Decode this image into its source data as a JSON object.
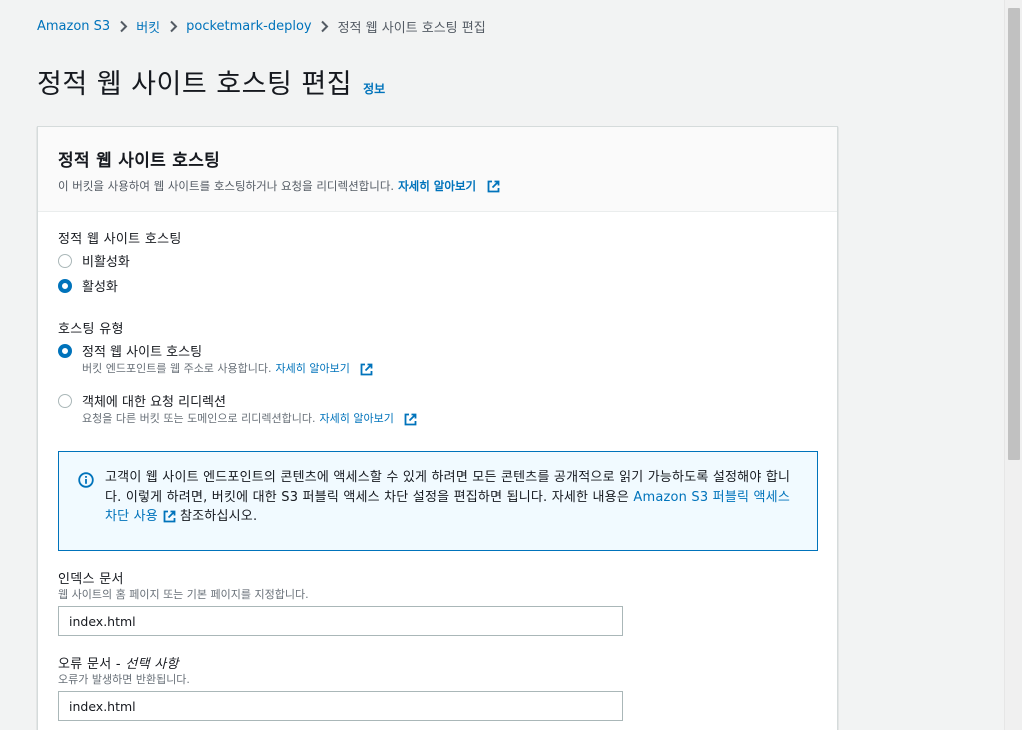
{
  "breadcrumb": {
    "items": [
      "Amazon S3",
      "버킷",
      "pocketmark-deploy"
    ],
    "current": "정적 웹 사이트 호스팅 편집"
  },
  "page": {
    "title": "정적 웹 사이트 호스팅 편집",
    "info_link": "정보"
  },
  "panel": {
    "title": "정적 웹 사이트 호스팅",
    "description": "이 버킷을 사용하여 웹 사이트를 호스팅하거나 요청을 리디렉션합니다.",
    "learn_more": "자세히 알아보기"
  },
  "hosting_toggle": {
    "label": "정적 웹 사이트 호스팅",
    "options": [
      {
        "label": "비활성화",
        "selected": false
      },
      {
        "label": "활성화",
        "selected": true
      }
    ]
  },
  "hosting_type": {
    "label": "호스팅 유형",
    "options": [
      {
        "label": "정적 웹 사이트 호스팅",
        "description": "버킷 엔드포인트를 웹 주소로 사용합니다.",
        "learn_more": "자세히 알아보기",
        "selected": true
      },
      {
        "label": "객체에 대한 요청 리디렉션",
        "description": "요청을 다른 버킷 또는 도메인으로 리디렉션합니다.",
        "learn_more": "자세히 알아보기",
        "selected": false
      }
    ]
  },
  "alert": {
    "text": "고객이 웹 사이트 엔드포인트의 콘텐츠에 액세스할 수 있게 하려면 모든 콘텐츠를 공개적으로 읽기 가능하도록 설정해야 합니다. 이렇게 하려면, 버킷에 대한 S3 퍼블릭 액세스 차단 설정을 편집하면 됩니다. 자세한 내용은",
    "link": "Amazon S3 퍼블릭 액세스 차단 사용",
    "suffix": "참조하십시오."
  },
  "index_document": {
    "label": "인덱스 문서",
    "description": "웹 사이트의 홈 페이지 또는 기본 페이지를 지정합니다.",
    "value": "index.html"
  },
  "error_document": {
    "label": "오류 문서 - ",
    "optional": "선택 사항",
    "description": "오류가 발생하면 반환됩니다.",
    "value": "index.html"
  },
  "colors": {
    "link": "#0073bb",
    "selected_radio": "#0073bb",
    "alert_bg": "#f1faff"
  }
}
